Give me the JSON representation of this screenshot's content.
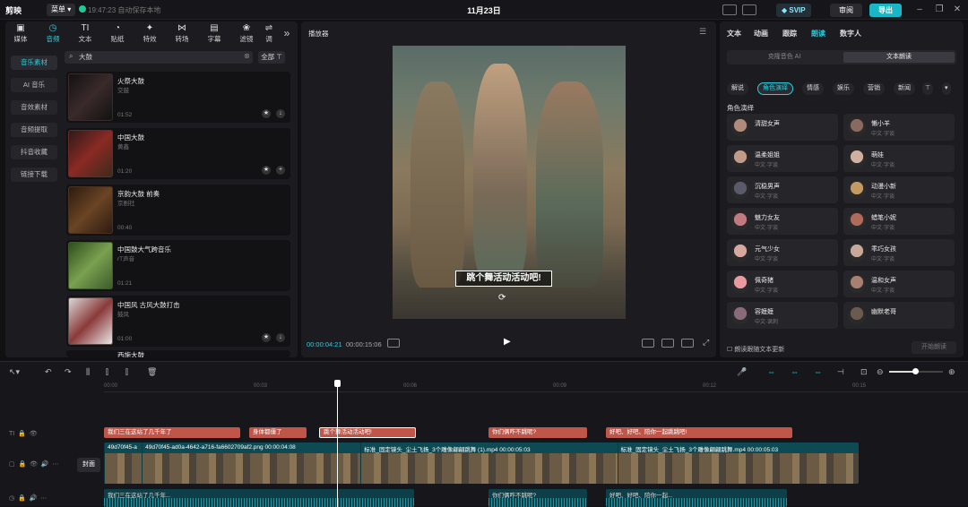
{
  "titlebar": {
    "logo": "剪映",
    "menu": "菜单",
    "save_status": "19:47:23 自动保存本地",
    "title": "11月23日",
    "svip": "SVIP",
    "review": "审阅",
    "export": "导出"
  },
  "media_tabs": [
    {
      "label": "媒体",
      "icon": "media-icon"
    },
    {
      "label": "音频",
      "icon": "audio-icon"
    },
    {
      "label": "文本",
      "icon": "text-icon"
    },
    {
      "label": "贴纸",
      "icon": "sticker-icon"
    },
    {
      "label": "特效",
      "icon": "effects-icon"
    },
    {
      "label": "转场",
      "icon": "transition-icon"
    },
    {
      "label": "字幕",
      "icon": "caption-icon"
    },
    {
      "label": "滤镜",
      "icon": "filter-icon"
    },
    {
      "label": "调",
      "icon": "adjust-icon"
    }
  ],
  "categories": [
    "音乐素材",
    "AI 音乐",
    "音效素材",
    "音频提取",
    "抖音收藏",
    "链接下载"
  ],
  "search": {
    "value": "大鼓",
    "all": "全部"
  },
  "tracks": [
    {
      "title": "火祭大鼓",
      "artist": "交鼓",
      "duration": "01:52",
      "color": "#3a2a2a"
    },
    {
      "title": "中国大鼓",
      "artist": "黄鑫",
      "duration": "01:20",
      "color": "#6a2a28"
    },
    {
      "title": "京韵大鼓 前奏",
      "artist": "京剧社",
      "duration": "00:40",
      "color": "#4a3220"
    },
    {
      "title": "中国鼓大气跨音乐",
      "artist": "rT声音",
      "duration": "01:21",
      "color": "#3e5a2a"
    },
    {
      "title": "中国风 古风大鼓打击",
      "artist": "鼓风",
      "duration": "01:00",
      "color": "#5a4a4a"
    }
  ],
  "partial_track": "西施大鼓",
  "player": {
    "title": "播放器",
    "subtitle": "跳个舞活动活动吧!",
    "time_current": "00:00:04:21",
    "time_total": "00:00:15:06"
  },
  "right_tabs": [
    "文本",
    "动画",
    "跟踪",
    "朗读",
    "数字人"
  ],
  "right_active_tab": "朗读",
  "voice_subtabs": [
    "克隆音色 AI",
    "文本朗读"
  ],
  "voice_chips": [
    "解说",
    "角色演绎",
    "情感",
    "娱乐",
    "营销",
    "新闻"
  ],
  "role_header": "角色演绎",
  "voices": [
    {
      "name": "清甜女声",
      "sub": "",
      "color": "#b08a7a"
    },
    {
      "name": "懒小羊",
      "sub": "中文·字谈",
      "color": "#8a6a60"
    },
    {
      "name": "温柔姐姐",
      "sub": "中文·字谈",
      "color": "#c29a88"
    },
    {
      "name": "萌娃",
      "sub": "中文·字谈",
      "color": "#d0b0a0"
    },
    {
      "name": "沉稳男声",
      "sub": "中文·字谈",
      "color": "#5a5a6a"
    },
    {
      "name": "动漫小新",
      "sub": "中文·字谈",
      "color": "#c49a60"
    },
    {
      "name": "魅力女友",
      "sub": "中文·字谈",
      "color": "#c07a80"
    },
    {
      "name": "蜡笔小妮",
      "sub": "中文·字谈",
      "color": "#b06a5a"
    },
    {
      "name": "元气少女",
      "sub": "中文·字谈",
      "color": "#d8a8a0"
    },
    {
      "name": "乖巧女孩",
      "sub": "中文·字谈",
      "color": "#c8a898"
    },
    {
      "name": "佩奇猪",
      "sub": "中文·字谈",
      "color": "#e89aa0"
    },
    {
      "name": "温和女声",
      "sub": "中文·字谈",
      "color": "#a88070"
    },
    {
      "name": "容嬷嬷",
      "sub": "中文·讽刺",
      "color": "#8a6a7a"
    },
    {
      "name": "幽默老哥",
      "sub": "",
      "color": "#6a5a50"
    }
  ],
  "update_check": "朗读跟随文本更新",
  "start_read": "开始朗读",
  "timeline": {
    "ticks": [
      "00:00",
      "00:03",
      "00:06",
      "00:09",
      "00:12",
      "00:15"
    ],
    "subtitle_clips": [
      "我们三在这站了几千年了",
      "身体都僵了",
      "跳个舞活动活动吧!",
      "你们俩咋不跳呢?",
      "好吧、好吧、陪你一起跳跳吧!"
    ],
    "video_segments": [
      {
        "label": "49d70f45-a",
        "w": 0.05
      },
      {
        "label": "49d70f45-ad0a-4642-a716-fa6602709af2.png  00:00:04:08",
        "w": 0.29
      },
      {
        "label": "标准_固定镜头_尘土飞扬_3个雕像翩翩跳舞 (1).mp4  00:00:05:03",
        "w": 0.34
      },
      {
        "label": "标准_固定镜头_尘土飞扬_3个雕像翩翩跳舞.mp4  00:00:05:03",
        "w": 0.32
      }
    ],
    "cover": "封面",
    "audio_clips": [
      "我们三在这站了几千年...",
      "你们俩咋不跳呢?",
      "好吧、好吧、陪你一起..."
    ]
  }
}
